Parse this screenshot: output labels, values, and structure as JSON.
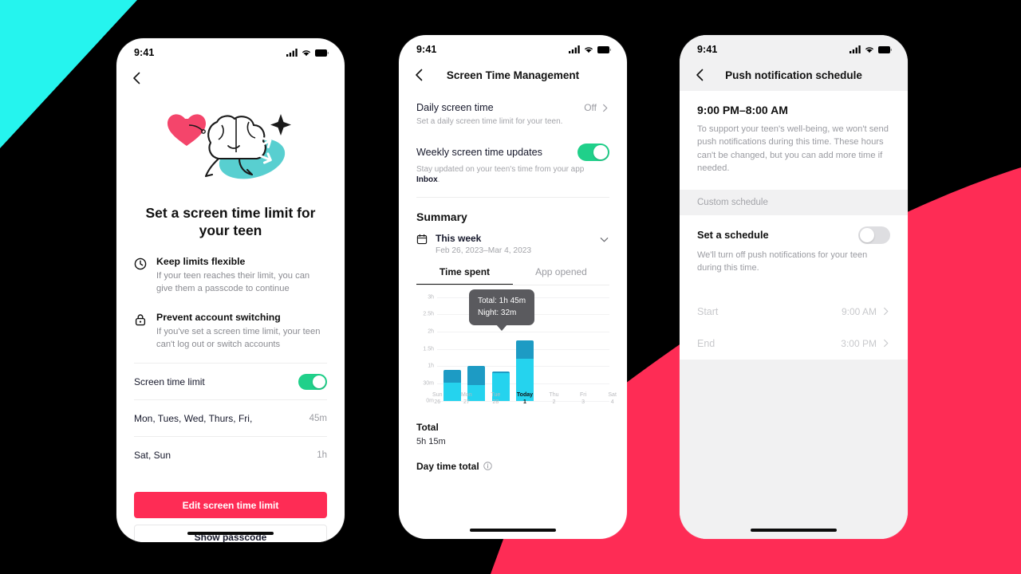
{
  "background": {
    "accent_cyan": "#25F4EE",
    "accent_red": "#FE2C55",
    "base": "#000000"
  },
  "phone1": {
    "status": {
      "time": "9:41",
      "icons": [
        "cellular-signal-icon",
        "wifi-icon",
        "battery-icon"
      ]
    },
    "nav": {
      "back": "back-chevron-icon"
    },
    "illustration": "running-brain-heart-sparkle-illustration",
    "title": "Set a screen time limit for your teen",
    "features": [
      {
        "icon": "clock-icon",
        "heading": "Keep limits flexible",
        "body": "If your teen reaches their limit, you can give them a passcode to continue"
      },
      {
        "icon": "lock-icon",
        "heading": "Prevent account switching",
        "body": "If you've set a screen time limit, your teen can't log out or switch accounts"
      }
    ],
    "toggle_row": {
      "label": "Screen time limit",
      "state": "on"
    },
    "schedule_rows": [
      {
        "label": "Mon, Tues, Wed, Thurs, Fri,",
        "value": "45m"
      },
      {
        "label": "Sat, Sun",
        "value": "1h"
      }
    ],
    "primary_button": "Edit screen time limit",
    "secondary_button": "Show passcode"
  },
  "phone2": {
    "status": {
      "time": "9:41"
    },
    "nav": {
      "title": "Screen Time Management"
    },
    "settings": [
      {
        "label": "Daily screen time",
        "value": "Off",
        "sub": "Set a daily screen time limit for your teen.",
        "control": "chevron"
      },
      {
        "label": "Weekly screen time updates",
        "sub_prefix": "Stay updated on your teen's time from your app ",
        "sub_bold": "Inbox",
        "sub_suffix": ".",
        "control": "toggle",
        "state": "on"
      }
    ],
    "summary": {
      "title": "Summary",
      "period_name": "This week",
      "period_range": "Feb 26, 2023–Mar 4, 2023",
      "calendar_icon": "calendar-icon",
      "chevron_icon": "chevron-down-icon",
      "tabs": [
        {
          "label": "Time spent",
          "active": true
        },
        {
          "label": "App opened",
          "active": false
        }
      ],
      "tooltip": {
        "line1": "Total: 1h 45m",
        "line2": "Night: 32m"
      },
      "total_heading": "Total",
      "total_value": "5h 15m",
      "daytime_heading": "Day time total",
      "info_icon": "info-icon"
    }
  },
  "chart_data": {
    "type": "bar",
    "title": "Time spent",
    "stacked": true,
    "categories": [
      "Sun",
      "Mon",
      "Tue",
      "Today",
      "Thu",
      "Fri",
      "Sat"
    ],
    "category_dates": [
      "26",
      "27",
      "28",
      "1",
      "2",
      "3",
      "4"
    ],
    "today_index": 3,
    "ylabel": "",
    "xlabel": "",
    "ytick_labels": [
      "0m",
      "30m",
      "1h",
      "1.5h",
      "2h",
      "2.5h",
      "3h"
    ],
    "ytick_values": [
      0,
      0.5,
      1,
      1.5,
      2,
      2.5,
      3
    ],
    "ylim": [
      0,
      3
    ],
    "grid": true,
    "legend_position": "none",
    "series": [
      {
        "name": "Day",
        "color": "#25D3EE",
        "values": [
          0.52,
          0.45,
          0.8,
          1.22,
          0,
          0,
          0
        ]
      },
      {
        "name": "Night",
        "color": "#1D9BC4",
        "values": [
          0.37,
          0.55,
          0.05,
          0.53,
          0,
          0,
          0
        ]
      }
    ],
    "totals": [
      0.89,
      1.0,
      0.85,
      1.75,
      0,
      0,
      0
    ],
    "annotation": "Total: 1h 45m / Night: 32m",
    "annotation_index": 3
  },
  "phone3": {
    "status": {
      "time": "9:41"
    },
    "nav": {
      "title": "Push notification schedule"
    },
    "quiet_hours": {
      "time_range": "9:00 PM–8:00 AM",
      "description": "To support your teen's well-being, we won't send push notifications during this time. These hours can't be changed, but you can add more time if needed."
    },
    "section_header": "Custom schedule",
    "set_schedule": {
      "heading": "Set a schedule",
      "sub": "We'll turn off push notifications for your teen during this time.",
      "state": "off"
    },
    "time_rows": [
      {
        "label": "Start",
        "value": "9:00 AM"
      },
      {
        "label": "End",
        "value": "3:00 PM"
      }
    ]
  }
}
